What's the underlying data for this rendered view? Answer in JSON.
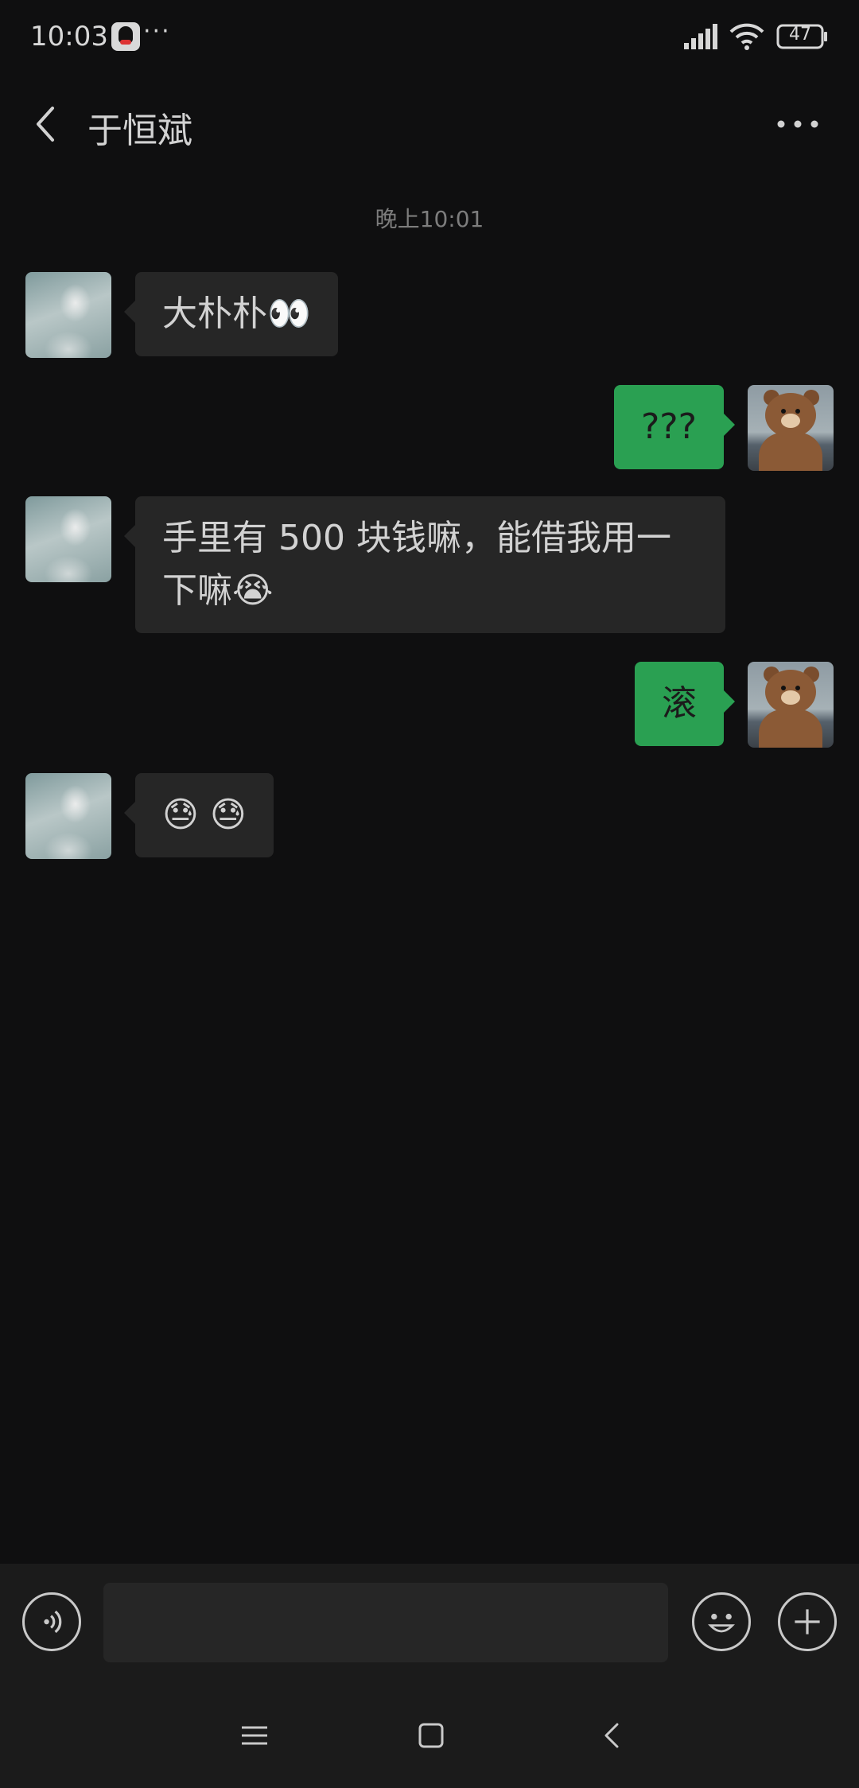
{
  "status_bar": {
    "time": "10:03",
    "more": "···",
    "battery": "47"
  },
  "header": {
    "title": "于恒斌"
  },
  "timestamp": "晚上10:01",
  "messages": [
    {
      "side": "left",
      "text": "大朴朴👀"
    },
    {
      "side": "right",
      "text": "???"
    },
    {
      "side": "left",
      "text": "手里有 500 块钱嘛，能借我用一下嘛😭"
    },
    {
      "side": "right",
      "text": "滚"
    },
    {
      "side": "left",
      "text": "😓 😓"
    }
  ],
  "input": {
    "placeholder": ""
  },
  "colors": {
    "background": "#0f0f10",
    "incoming_bubble": "#262626",
    "outgoing_bubble": "#2aa052",
    "bar": "#1b1b1b"
  },
  "icons": {
    "back": "chevron-left-icon",
    "more": "more-horizontal-icon",
    "voice": "voice-icon",
    "emoji": "smiley-icon",
    "plus": "plus-icon"
  }
}
